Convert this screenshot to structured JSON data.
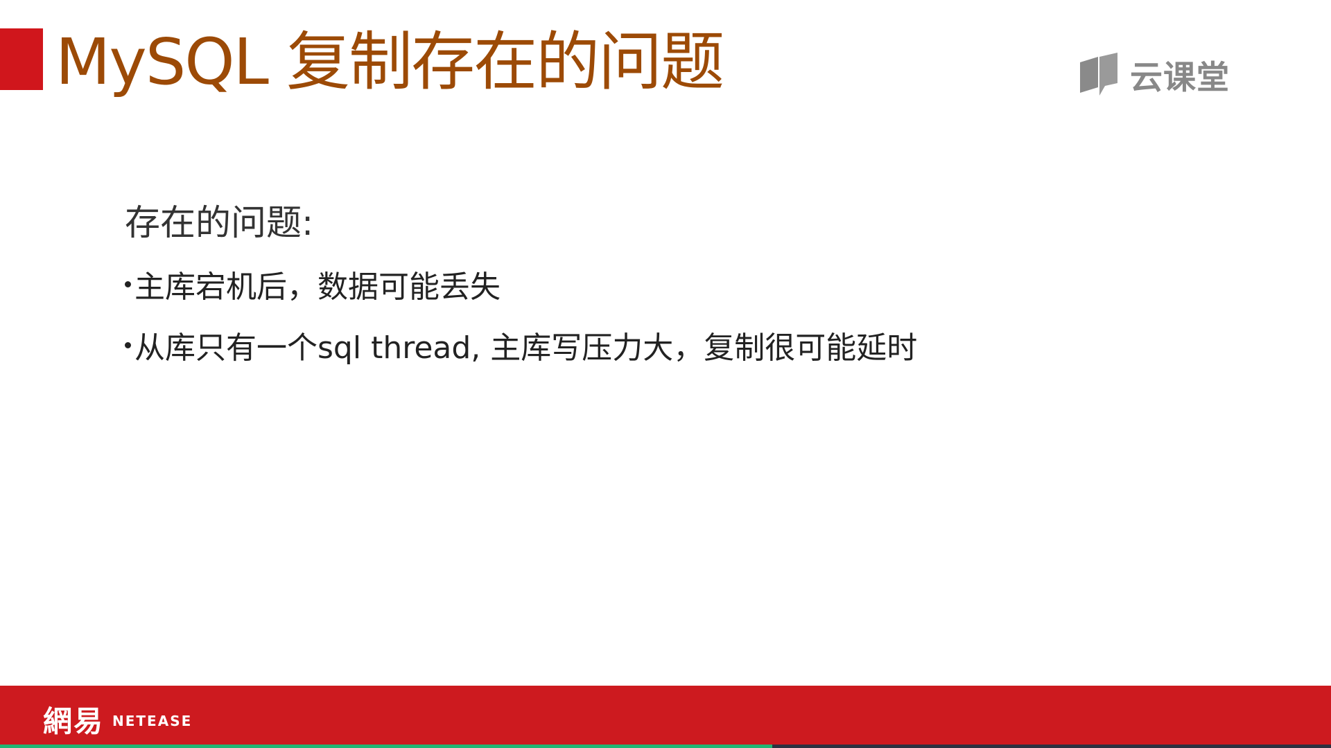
{
  "slide": {
    "title": "MySQL 复制存在的问题",
    "brand": {
      "icon": "cloud-classroom-logo-icon",
      "label": "云课堂"
    },
    "subheading": "存在的问题:",
    "bullets": [
      {
        "text": "主库宕机后，数据可能丢失"
      },
      {
        "text": "从库只有一个sql thread, 主库写压力大，复制很可能延时"
      }
    ]
  },
  "footer": {
    "logo_cn": "網易",
    "logo_en": "NetEase"
  },
  "playback": {
    "progress": 0.58
  },
  "colors": {
    "accent_red": "#d0161c",
    "title_brown": "#9c4a06",
    "footer_red": "#cd1a1f",
    "progress_green": "#21b573"
  }
}
